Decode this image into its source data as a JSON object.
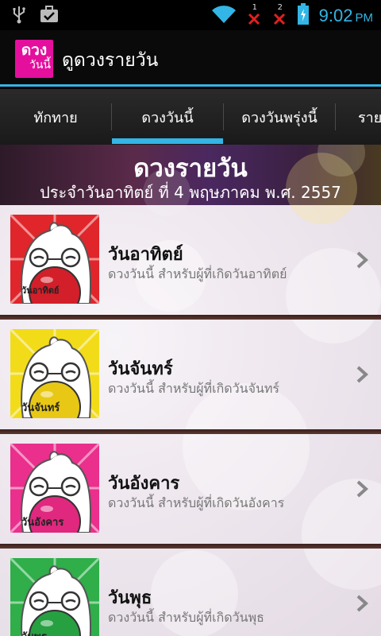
{
  "status_bar": {
    "icons": [
      "usb-icon",
      "briefcase-icon",
      "wifi-icon",
      "notification-1-icon",
      "notification-2-icon",
      "battery-icon"
    ],
    "time": "9:02",
    "ampm": "PM",
    "notif_counts": [
      "1",
      "2"
    ],
    "accent": "#33b5e5"
  },
  "app_bar": {
    "logo_line1": "ดวง",
    "logo_line2": "วันนี้",
    "title": "ดูดวงรายวัน",
    "logo_color": "#e40f9d"
  },
  "tabs": [
    {
      "label": "ทักทาย"
    },
    {
      "label": "ดวงวันนี้",
      "selected": true
    },
    {
      "label": "ดวงวันพรุ่งนี้"
    },
    {
      "label": "ราย"
    }
  ],
  "banner": {
    "title": "ดวงรายวัน",
    "subtitle": "ประจำวันอาทิตย์ ที่ 4 พฤษภาคม พ.ศ. 2557"
  },
  "items": [
    {
      "title": "วันอาทิตย์",
      "subtitle": "ดวงวันนี้ สำหรับผู้ที่เกิดวันอาทิตย์",
      "badge": "วันอาทิตย์",
      "color": "#e0262b",
      "ball": "#d21f2a"
    },
    {
      "title": "วันจันทร์",
      "subtitle": "ดวงวันนี้ สำหรับผู้ที่เกิดวันจันทร์",
      "badge": "วันจันทร์",
      "color": "#f2dc1a",
      "ball": "#e8c815"
    },
    {
      "title": "วันอังคาร",
      "subtitle": "ดวงวันนี้ สำหรับผู้ที่เกิดวันอังคาร",
      "badge": "วันอังคาร",
      "color": "#ea2f8c",
      "ball": "#e0287f"
    },
    {
      "title": "วันพุธ",
      "subtitle": "ดวงวันนี้ สำหรับผู้ที่เกิดวันพุธ",
      "badge": "วันพุธ",
      "color": "#2fae4a",
      "ball": "#27a042"
    }
  ]
}
